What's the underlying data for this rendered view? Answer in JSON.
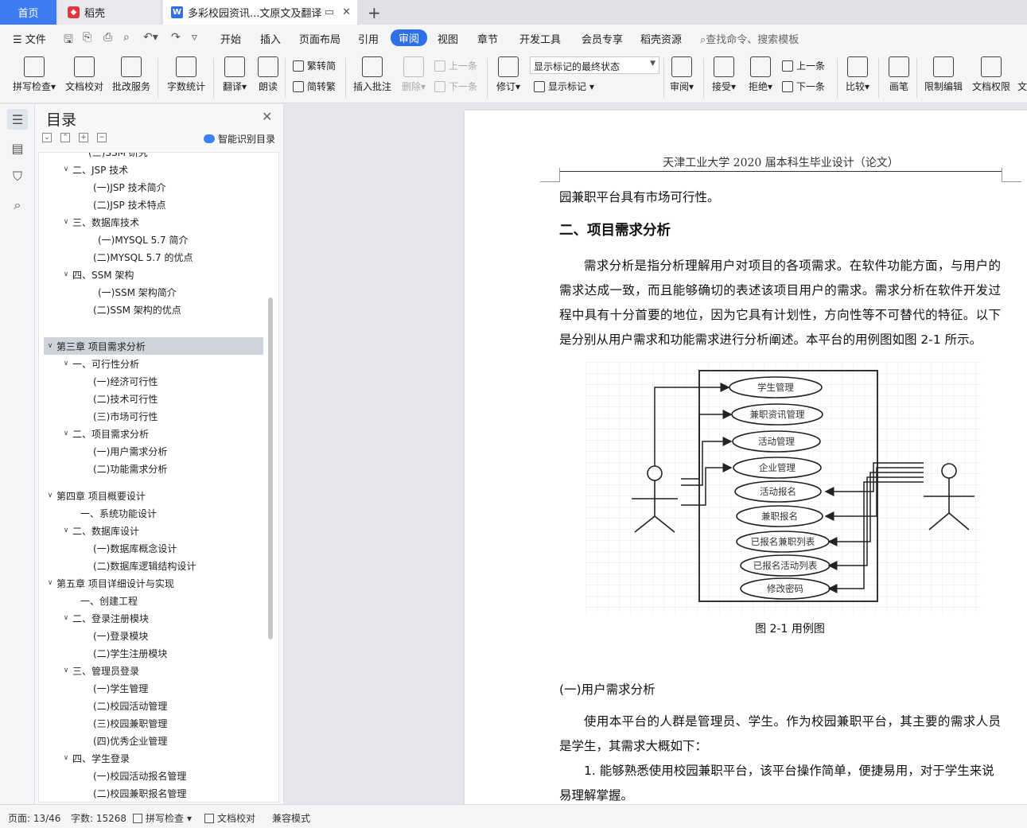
{
  "tabs": {
    "home": "首页",
    "daoke": "稻壳",
    "doc": "多彩校园资讯...文原文及翻译"
  },
  "menu": {
    "file": "文件",
    "items": [
      "开始",
      "插入",
      "页面布局",
      "引用",
      "审阅",
      "视图",
      "章节",
      "开发工具",
      "会员专享",
      "稻壳资源"
    ],
    "active": "审阅",
    "search": "查找命令、搜索模板"
  },
  "ribbon": {
    "spell_check": "拼写检查",
    "doc_proof": "文档校对",
    "batch_service": "批改服务",
    "word_count": "字数统计",
    "translate": "翻译",
    "read_aloud": "朗读",
    "trad_simp": "繁转简",
    "simp_trad": "简转繁",
    "insert_comment": "插入批注",
    "delete": "删除",
    "prev_comment": "上一条",
    "next_comment": "下一条",
    "track_changes": "修订",
    "markup_mode": "显示标记的最终状态",
    "show_markup": "显示标记",
    "review_pane": "审阅",
    "accept": "接受",
    "reject": "拒绝",
    "prev_change": "上一条",
    "next_change": "下一条",
    "compare": "比较",
    "ink": "画笔",
    "restrict_edit": "限制编辑",
    "doc_permission": "文档权限",
    "doc_cut": "文"
  },
  "toc": {
    "title": "目录",
    "smart": "智能识别目录",
    "items": [
      {
        "label": "(三)SSM 研究",
        "caret": ""
      },
      {
        "label": "二、JSP 技术",
        "caret": "v"
      },
      {
        "label": "(一)JSP 技术简介",
        "caret": ""
      },
      {
        "label": "(二)JSP 技术特点",
        "caret": ""
      },
      {
        "label": "三、数据库技术",
        "caret": "v"
      },
      {
        "label": "(一)MYSQL 5.7 简介",
        "caret": ""
      },
      {
        "label": "(二)MYSQL 5.7 的优点",
        "caret": ""
      },
      {
        "label": "四、SSM 架构",
        "caret": "v"
      },
      {
        "label": "(一)SSM 架构简介",
        "caret": ""
      },
      {
        "label": "(二)SSM 架构的优点",
        "caret": ""
      },
      {
        "label": "第三章  项目需求分析",
        "caret": "v"
      },
      {
        "label": "一、可行性分析",
        "caret": "v"
      },
      {
        "label": "(一)经济可行性",
        "caret": ""
      },
      {
        "label": "(二)技术可行性",
        "caret": ""
      },
      {
        "label": "(三)市场可行性",
        "caret": ""
      },
      {
        "label": "二、项目需求分析",
        "caret": "v"
      },
      {
        "label": "(一)用户需求分析",
        "caret": ""
      },
      {
        "label": "(二)功能需求分析",
        "caret": ""
      },
      {
        "label": "第四章  项目概要设计",
        "caret": "v"
      },
      {
        "label": "一、系统功能设计",
        "caret": ""
      },
      {
        "label": "二、数据库设计",
        "caret": "v"
      },
      {
        "label": "(一)数据库概念设计",
        "caret": ""
      },
      {
        "label": "(二)数据库逻辑结构设计",
        "caret": ""
      },
      {
        "label": "第五章  项目详细设计与实现",
        "caret": "v"
      },
      {
        "label": "一、创建工程",
        "caret": ""
      },
      {
        "label": "二、登录注册模块",
        "caret": "v"
      },
      {
        "label": "(一)登录模块",
        "caret": ""
      },
      {
        "label": "(二)学生注册模块",
        "caret": ""
      },
      {
        "label": "三、管理员登录",
        "caret": "v"
      },
      {
        "label": "(一)学生管理",
        "caret": ""
      },
      {
        "label": "(二)校园活动管理",
        "caret": ""
      },
      {
        "label": "(三)校园兼职管理",
        "caret": ""
      },
      {
        "label": "(四)优秀企业管理",
        "caret": ""
      },
      {
        "label": "四、学生登录",
        "caret": "v"
      },
      {
        "label": "(一)校园活动报名管理",
        "caret": ""
      },
      {
        "label": "(二)校园兼职报名管理",
        "caret": ""
      }
    ]
  },
  "document": {
    "header": "天津工业大学 2020 届本科生毕业设计（论文）",
    "line1": "园兼职平台具有市场可行性。",
    "heading": "二、项目需求分析",
    "para1": "需求分析是指分析理解用户对项目的各项需求。在软件功能方面，与用户的需求达成一致，而且能够确切的表述该项目用户的需求。需求分析在软件开发过程中具有十分首要的地位，因为它具有计划性，方向性等不可替代的特征。以下是分别从用户需求和功能需求进行分析阐述。本平台的用例图如图 2-1 所示。",
    "use_cases": [
      "学生管理",
      "兼职资讯管理",
      "活动管理",
      "企业管理",
      "活动报名",
      "兼职报名",
      "已报名兼职列表",
      "已报名活动列表",
      "修改密码"
    ],
    "figure_caption": "图 2-1 用例图",
    "subheading": "(一)用户需求分析",
    "para2": "使用本平台的人群是管理员、学生。作为校园兼职平台，其主要的需求人员是学生，其需求大概如下：",
    "list1": "1.  能够熟悉使用校园兼职平台，该平台操作简单，便捷易用，对于学生来说易理解掌握。"
  },
  "status": {
    "page": "页面: 13/46",
    "words": "字数: 15268",
    "spell": "拼写检查",
    "proof": "文档校对",
    "compat": "兼容模式"
  }
}
